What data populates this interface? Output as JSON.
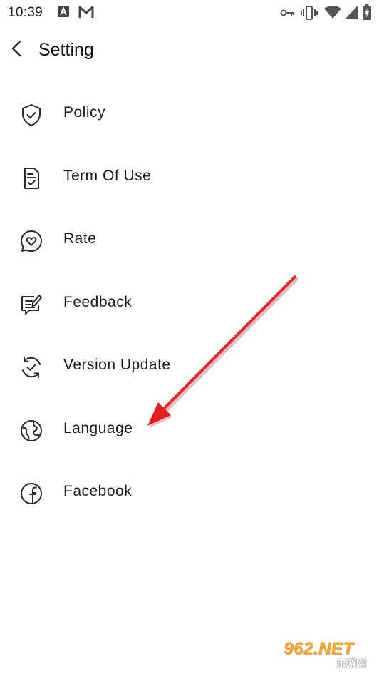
{
  "status_bar": {
    "time": "10:39",
    "left_icons": [
      "a-app-icon",
      "gmail-icon"
    ],
    "right_icons": [
      "vpn-key-icon",
      "vibrate-icon",
      "wifi-icon",
      "signal-icon",
      "battery-charging-icon"
    ]
  },
  "header": {
    "back_icon": "chevron-left-icon",
    "title": "Setting"
  },
  "menu": {
    "items": [
      {
        "label": "Policy",
        "icon": "shield-check-icon"
      },
      {
        "label": "Term Of Use",
        "icon": "document-check-icon"
      },
      {
        "label": "Rate",
        "icon": "heart-chat-icon"
      },
      {
        "label": "Feedback",
        "icon": "feedback-edit-icon"
      },
      {
        "label": "Version Update",
        "icon": "refresh-check-icon"
      },
      {
        "label": "Language",
        "icon": "globe-icon"
      },
      {
        "label": "Facebook",
        "icon": "facebook-icon"
      }
    ]
  },
  "annotation": {
    "color": "#e02020"
  },
  "watermark": {
    "text": "962.NET",
    "sub_text": "乐游网"
  },
  "colors": {
    "background": "#ffffff",
    "text": "#1c1c1c",
    "icon": "#2a2a2a"
  }
}
